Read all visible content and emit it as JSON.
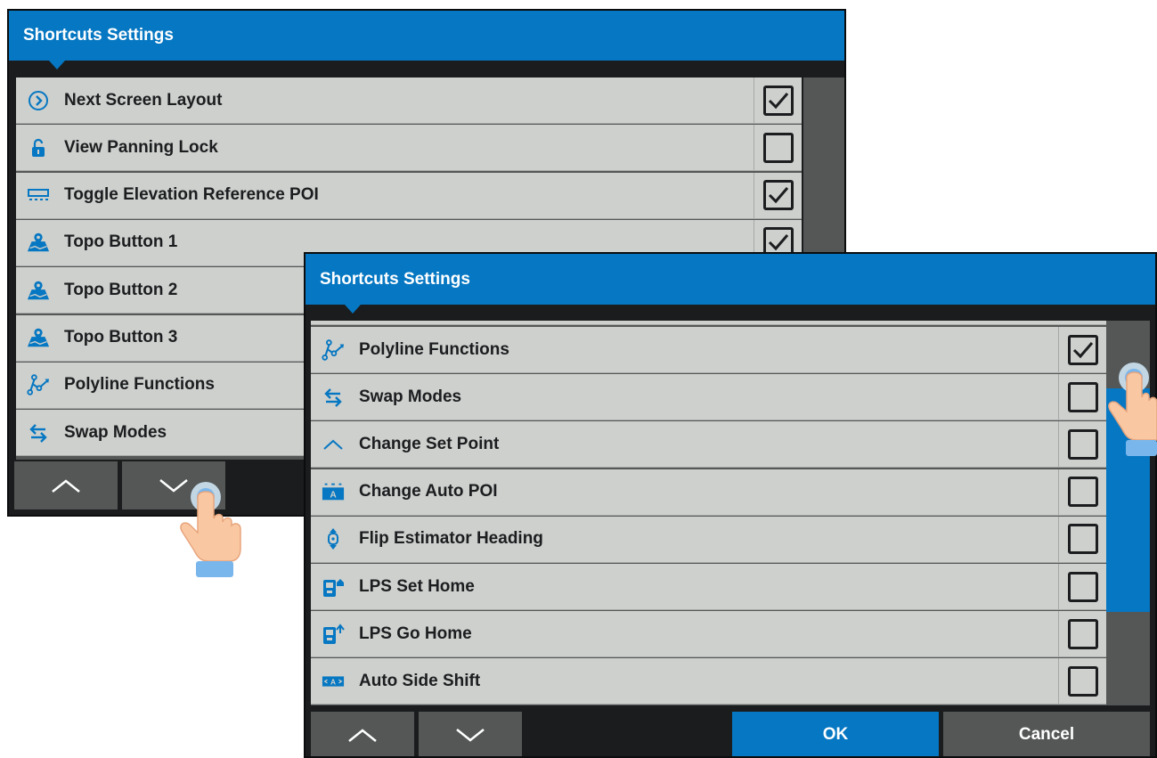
{
  "dialog1": {
    "title": "Shortcuts Settings",
    "rows": [
      {
        "label": "Next Screen Layout",
        "icon": "next-screen-icon",
        "checked": true
      },
      {
        "label": "View Panning Lock",
        "icon": "lock-icon",
        "checked": false
      },
      {
        "label": "Toggle Elevation Reference POI",
        "icon": "elevation-reference-icon",
        "checked": true
      },
      {
        "label": "Topo Button 1",
        "icon": "topo-map-icon",
        "checked": true
      },
      {
        "label": "Topo Button 2",
        "icon": "topo-map-icon",
        "checked": null
      },
      {
        "label": "Topo Button 3",
        "icon": "topo-map-icon",
        "checked": null
      },
      {
        "label": "Polyline Functions",
        "icon": "polyline-icon",
        "checked": null
      },
      {
        "label": "Swap Modes",
        "icon": "swap-icon",
        "checked": null
      }
    ],
    "footer": {
      "up_icon": "chevron-up-icon",
      "down_icon": "chevron-down-icon"
    }
  },
  "dialog2": {
    "title": "Shortcuts Settings",
    "rows": [
      {
        "label": "Polyline Functions",
        "icon": "polyline-icon",
        "checked": true
      },
      {
        "label": "Swap Modes",
        "icon": "swap-icon",
        "checked": false
      },
      {
        "label": "Change Set Point",
        "icon": "set-point-icon",
        "checked": false
      },
      {
        "label": "Change Auto POI",
        "icon": "auto-poi-icon",
        "checked": false
      },
      {
        "label": "Flip Estimator Heading",
        "icon": "flip-heading-icon",
        "checked": false
      },
      {
        "label": "LPS Set Home",
        "icon": "lps-set-home-icon",
        "checked": false
      },
      {
        "label": "LPS Go Home",
        "icon": "lps-go-home-icon",
        "checked": false
      },
      {
        "label": "Auto Side Shift",
        "icon": "auto-side-shift-icon",
        "checked": false
      }
    ],
    "footer": {
      "up_icon": "chevron-up-icon",
      "down_icon": "chevron-down-icon",
      "ok_label": "OK",
      "cancel_label": "Cancel"
    },
    "scroll_position": 0.42
  },
  "colors": {
    "accent": "#0677c2",
    "row_bg": "#cdd0cd",
    "frame": "#1a1c1d",
    "button_bg": "#545756",
    "text": "#1b1d1f",
    "hand_skin": "#f9c8a3",
    "hand_cuff": "#79b6ec"
  },
  "hands": [
    {
      "target": "dialog1-scroll-down-button",
      "icon": "tap-gesture-icon"
    },
    {
      "target": "dialog2-scrollbar",
      "icon": "tap-gesture-icon"
    }
  ]
}
